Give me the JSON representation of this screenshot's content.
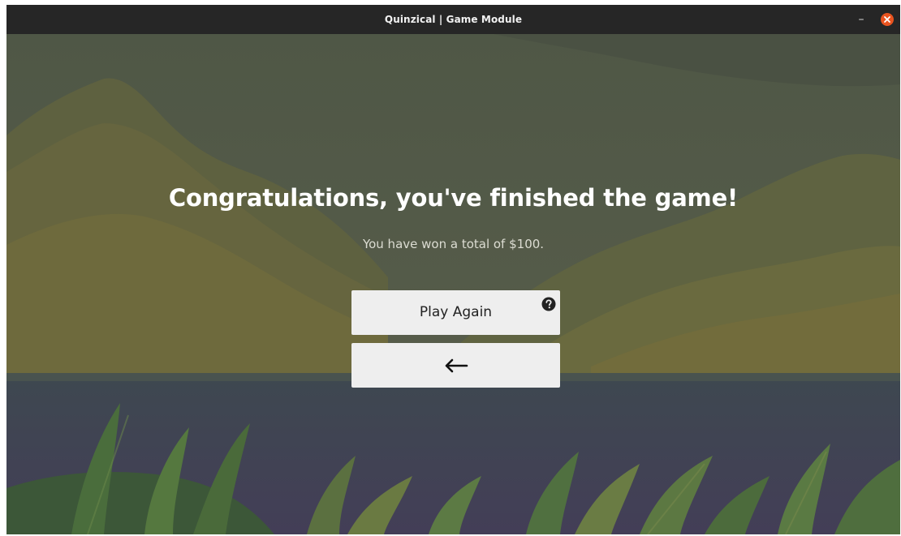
{
  "window": {
    "title": "Quinzical | Game Module",
    "minimize_glyph": "–",
    "close_icon": "close-icon",
    "close_color": "#e95420"
  },
  "game_over": {
    "heading": "Congratulations, you've finished the game!",
    "winnings_text": "You have won a total of $100."
  },
  "buttons": {
    "play_again_label": "Play Again",
    "help_icon": "question-circle-icon",
    "back_icon": "arrow-left-icon"
  },
  "colors": {
    "button_bg": "#eeeeee",
    "heading": "#ffffff",
    "subtext": "#dcdcd2"
  }
}
